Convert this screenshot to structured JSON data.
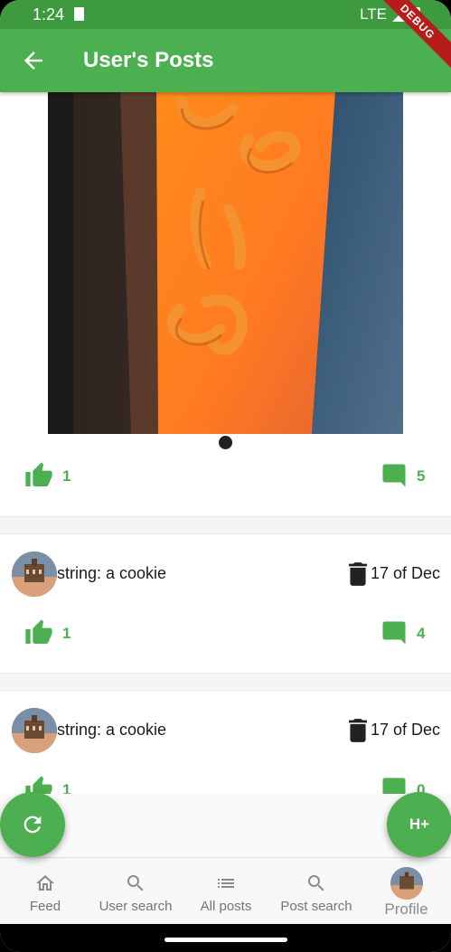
{
  "status_bar": {
    "time": "1:24",
    "network": "LTE"
  },
  "app_bar": {
    "title": "User's Posts"
  },
  "debug_banner": "DEBUG",
  "posts": [
    {
      "likes": "1",
      "comments": "5"
    },
    {
      "author_text": "string: a cookie",
      "date": "17 of Dec",
      "likes": "1",
      "comments": "4"
    },
    {
      "author_text": "string: a cookie",
      "date": "17 of Dec",
      "likes": "1",
      "comments": "0"
    }
  ],
  "fabs": {
    "right_label": "H+"
  },
  "bottom_nav": [
    {
      "label": "Feed",
      "icon": "home-icon"
    },
    {
      "label": "User search",
      "icon": "search-icon"
    },
    {
      "label": "All posts",
      "icon": "list-icon"
    },
    {
      "label": "Post search",
      "icon": "search-icon"
    },
    {
      "label": "Profile",
      "icon": "avatar"
    }
  ],
  "colors": {
    "primary": "#4caf50",
    "status_bar": "#3e9a3f",
    "debug": "#b71c1c"
  }
}
